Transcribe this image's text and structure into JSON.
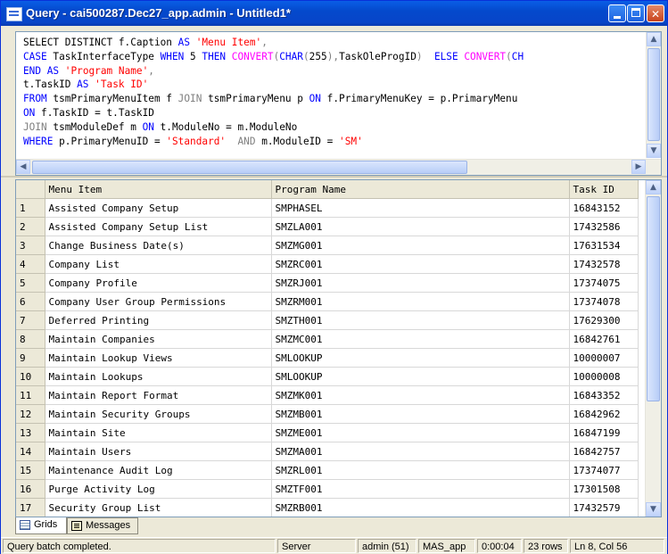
{
  "window": {
    "title": "Query - cai500287.Dec27_app.admin - Untitled1*"
  },
  "sql": {
    "lines": [
      [
        [
          "plain",
          "SELECT DISTINCT f.Caption "
        ],
        [
          "kw",
          "AS"
        ],
        [
          "plain",
          " "
        ],
        [
          "str",
          "'Menu Item'"
        ],
        [
          "gr",
          ","
        ]
      ],
      [
        [
          "kw",
          "CASE"
        ],
        [
          "plain",
          " TaskInterfaceType "
        ],
        [
          "kw",
          "WHEN"
        ],
        [
          "plain",
          " 5 "
        ],
        [
          "kw",
          "THEN"
        ],
        [
          "plain",
          " "
        ],
        [
          "fn",
          "CONVERT"
        ],
        [
          "gr",
          "("
        ],
        [
          "kw",
          "CHAR"
        ],
        [
          "gr",
          "("
        ],
        [
          "plain",
          "255"
        ],
        [
          "gr",
          "),"
        ],
        [
          "plain",
          "TaskOleProgID"
        ],
        [
          "gr",
          ")"
        ],
        [
          "plain",
          "  "
        ],
        [
          "kw",
          "ELSE"
        ],
        [
          "plain",
          " "
        ],
        [
          "fn",
          "CONVERT"
        ],
        [
          "gr",
          "("
        ],
        [
          "kw",
          "CH"
        ]
      ],
      [
        [
          "kw",
          "END"
        ],
        [
          "plain",
          " "
        ],
        [
          "kw",
          "AS"
        ],
        [
          "plain",
          " "
        ],
        [
          "str",
          "'Program Name'"
        ],
        [
          "gr",
          ","
        ]
      ],
      [
        [
          "plain",
          "t.TaskID "
        ],
        [
          "kw",
          "AS"
        ],
        [
          "plain",
          " "
        ],
        [
          "str",
          "'Task ID'"
        ]
      ],
      [
        [
          "kw",
          "FROM"
        ],
        [
          "plain",
          " tsmPrimaryMenuItem f "
        ],
        [
          "gr",
          "JOIN"
        ],
        [
          "plain",
          " tsmPrimaryMenu p "
        ],
        [
          "kw",
          "ON"
        ],
        [
          "plain",
          " f.PrimaryMenuKey = p.PrimaryMenu"
        ]
      ],
      [
        [
          "kw",
          "ON"
        ],
        [
          "plain",
          " f.TaskID = t.TaskID"
        ]
      ],
      [
        [
          "gr",
          "JOIN"
        ],
        [
          "plain",
          " tsmModuleDef m "
        ],
        [
          "kw",
          "ON"
        ],
        [
          "plain",
          " t.ModuleNo = m.ModuleNo"
        ]
      ],
      [
        [
          "kw",
          "WHERE"
        ],
        [
          "plain",
          " p.PrimaryMenuID = "
        ],
        [
          "str",
          "'Standard'"
        ],
        [
          "plain",
          "  "
        ],
        [
          "gr",
          "AND"
        ],
        [
          "plain",
          " m.ModuleID = "
        ],
        [
          "str",
          "'SM'"
        ]
      ]
    ]
  },
  "results": {
    "columns": [
      "Menu Item",
      "Program Name",
      "Task ID"
    ],
    "rows": [
      [
        "1",
        "Assisted Company Setup",
        "SMPHASEL",
        "16843152"
      ],
      [
        "2",
        "Assisted Company Setup List",
        "SMZLA001",
        "17432586"
      ],
      [
        "3",
        "Change Business Date(s)",
        "SMZMG001",
        "17631534"
      ],
      [
        "4",
        "Company List",
        "SMZRC001",
        "17432578"
      ],
      [
        "5",
        "Company Profile",
        "SMZRJ001",
        "17374075"
      ],
      [
        "6",
        "Company User Group Permissions",
        "SMZRM001",
        "17374078"
      ],
      [
        "7",
        "Deferred Printing",
        "SMZTH001",
        "17629300"
      ],
      [
        "8",
        "Maintain Companies",
        "SMZMC001",
        "16842761"
      ],
      [
        "9",
        "Maintain Lookup Views",
        "SMLOOKUP",
        "10000007"
      ],
      [
        "10",
        "Maintain Lookups",
        "SMLOOKUP",
        "10000008"
      ],
      [
        "11",
        "Maintain Report Format",
        "SMZMK001",
        "16843352"
      ],
      [
        "12",
        "Maintain Security Groups",
        "SMZMB001",
        "16842962"
      ],
      [
        "13",
        "Maintain Site",
        "SMZME001",
        "16847199"
      ],
      [
        "14",
        "Maintain Users",
        "SMZMA001",
        "16842757"
      ],
      [
        "15",
        "Maintenance Audit Log",
        "SMZRL001",
        "17374077"
      ],
      [
        "16",
        "Purge Activity Log",
        "SMZTF001",
        "17301508"
      ],
      [
        "17",
        "Security Group List",
        "SMZRB001",
        "17432579"
      ]
    ]
  },
  "tabs": {
    "grids": "Grids",
    "messages": "Messages"
  },
  "status": {
    "message": "Query batch completed.",
    "server": "Server",
    "user": "admin (51)",
    "database": "MAS_app",
    "elapsed": "0:00:04",
    "rows": "23 rows",
    "position": "Ln 8, Col 56"
  }
}
